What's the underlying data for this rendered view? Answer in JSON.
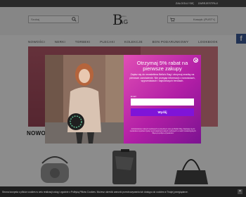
{
  "topbar": {
    "links": [
      "ZALOGUJ SIĘ",
      "ZAREJESTRUJ"
    ]
  },
  "header": {
    "search_placeholder": "Szukaj",
    "logo_letter": "B",
    "logo_word": "AG",
    "logo_small": "Bella's",
    "cart_label": "Koszyk: (PUSTY)"
  },
  "nav": {
    "items": [
      "NOWOŚCI",
      "NERKI",
      "TORBEKI",
      "PLECAKI",
      "KOLEKCJE",
      "BON PODARUNKOWY",
      "LOOKBOOK"
    ]
  },
  "popup": {
    "heading": "Otrzymaj 5% rabat na pierwsze zakupy",
    "description": "Zapisz się do newslettera Bella's Bag i otrzymuj znaćkę na pierwsze zamówienie. Nie przegap informacji o nowościach, wyprzedażach i najnowszych trendach.",
    "email_label": "Email",
    "email_value": "",
    "submit_label": "Wyślij",
    "legal": "Administratorem danych osobowych w powyższym celu jest Bella's Bag. Zapisując się do newslettera wyrażasz zgodę na przetwarzanie danych osobowych w celach marketingowych. Więcej w polityce prywatności."
  },
  "content": {
    "section_title": "NOWOŚ"
  },
  "cookie": {
    "text": "Strona korzysta z plików cookies w celu realizacji usług i zgodnie z Polityką Plików Cookies. Możesz określić warunki przechowywania lub dostępu do cookies w Twojej przeglądarce.",
    "close_label": "×"
  },
  "social": {
    "facebook_label": "f"
  },
  "colors": {
    "popup_gradient": [
      "#e04fb5",
      "#7b1391"
    ],
    "submit": "#7f14d8",
    "facebook": "#3b5998"
  }
}
